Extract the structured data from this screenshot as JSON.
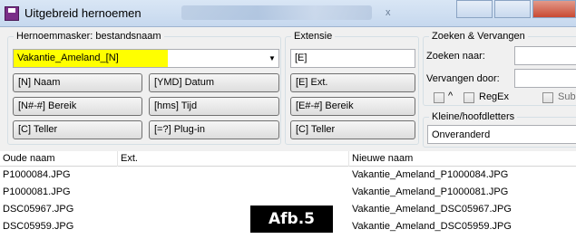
{
  "window": {
    "title": "Uitgebreid hernoemen",
    "title_blurred_mark": "x"
  },
  "name_mask": {
    "legend": "Hernoemmasker: bestandsnaam",
    "value": "Vakantie_Ameland_[N]",
    "highlight_color": "#ffff00",
    "buttons": [
      "[N] Naam",
      "[YMD] Datum",
      "[N#-#] Bereik",
      "[hms] Tijd",
      "[C] Teller",
      "[=?] Plug-in"
    ]
  },
  "extension": {
    "legend": "Extensie",
    "value": "[E]",
    "buttons": [
      "[E] Ext.",
      "[E#-#] Bereik",
      "[C] Teller"
    ]
  },
  "search_replace": {
    "legend": "Zoeken & Vervangen",
    "search_label": "Zoeken naar:",
    "replace_label": "Vervangen door:",
    "search_value": "",
    "replace_value": "",
    "caret_label": "^",
    "regex_label": "RegEx",
    "subst_label": "Sub"
  },
  "case": {
    "legend": "Kleine/hoofdletters",
    "value": "Onveranderd"
  },
  "file_list": {
    "columns": [
      "Oude naam",
      "Ext.",
      "Nieuwe naam"
    ],
    "rows": [
      {
        "old": "P1000084.JPG",
        "ext": "",
        "new": "Vakantie_Ameland_P1000084.JPG"
      },
      {
        "old": "P1000081.JPG",
        "ext": "",
        "new": "Vakantie_Ameland_P1000081.JPG"
      },
      {
        "old": "DSC05967.JPG",
        "ext": "",
        "new": "Vakantie_Ameland_DSC05967.JPG"
      },
      {
        "old": "DSC05959.JPG",
        "ext": "",
        "new": "Vakantie_Ameland_DSC05959.JPG"
      }
    ]
  },
  "overlay_label": "Afb.5"
}
